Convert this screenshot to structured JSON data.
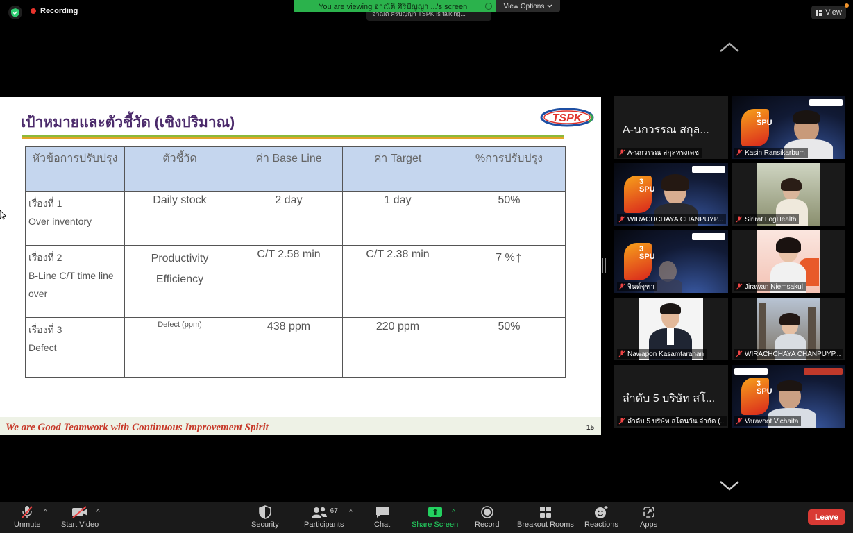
{
  "topbar": {
    "recording": "Recording",
    "viewing_banner": "You are viewing อาณัติ ศิริปัญญา ...'s screen",
    "view_options": "View Options",
    "talking": "อาณัติ ศิริปัญญา TSPK is talking...",
    "view_button": "View"
  },
  "slide": {
    "title": "เป้าหมายและตัวชี้วัด (เชิงปริมาณ)",
    "logo_text": "TSPK",
    "table": {
      "headers": [
        "หัวข้อการปรับปรุง",
        "ตัวชี้วัด",
        "ค่า Base Line",
        "ค่า Target",
        "%การปรับปรุง"
      ],
      "rows": [
        {
          "topic_line1": "เรื่องที่ 1",
          "topic_line2": "Over inventory",
          "indicator": "Daily stock",
          "baseline": "2 day",
          "target": "1 day",
          "improvement": "50%"
        },
        {
          "topic_line1": "เรื่องที่ 2",
          "topic_line2": "B-Line C/T time line over",
          "indicator_line1": "Productivity",
          "indicator_line2": "Efficiency",
          "baseline": "C/T 2.58 min",
          "target": "C/T 2.38 min",
          "improvement": "7 %"
        },
        {
          "topic_line1": "เรื่องที่ 3",
          "topic_line2": "Defect",
          "indicator": "Defect (ppm)",
          "baseline": "438 ppm",
          "target": "220 ppm",
          "improvement": "50%"
        }
      ]
    },
    "footer": "We are Good Teamwork with Continuous Improvement Spirit",
    "page_number": "15"
  },
  "gallery": [
    {
      "name": "A-นกวรรณ สกุลทรงเดช",
      "big_label": "A-นกวรรณ สกุล..."
    },
    {
      "name": "Kasin Ransikarbum"
    },
    {
      "name": "WIRACHCHAYA CHANPUYP..."
    },
    {
      "name": "Sirirat LogHealth"
    },
    {
      "name": "จินต์จุฑา"
    },
    {
      "name": "Jirawan Niemsakul"
    },
    {
      "name": "Nawapon Kasamtaranan"
    },
    {
      "name": "WIRACHCHAYA CHANPUYP..."
    },
    {
      "name": "ลำดับ 5 บริษัท สโตนวัน จำกัด (...",
      "big_label": "ลำดับ 5 บริษัท สโ..."
    },
    {
      "name": "Varavoot Vichaita"
    }
  ],
  "spu": {
    "digit": "3",
    "letters": "SPU"
  },
  "toolbar": {
    "unmute": "Unmute",
    "start_video": "Start Video",
    "security": "Security",
    "participants": "Participants",
    "participants_count": "67",
    "chat": "Chat",
    "share_screen": "Share Screen",
    "record": "Record",
    "breakout_rooms": "Breakout Rooms",
    "reactions": "Reactions",
    "apps": "Apps",
    "leave": "Leave"
  },
  "colors": {
    "share_green": "#23d160",
    "leave_red": "#d93a34",
    "banner_green": "#2bb24c",
    "title_purple": "#4b2a6b",
    "header_blue": "#c5d6ee"
  }
}
